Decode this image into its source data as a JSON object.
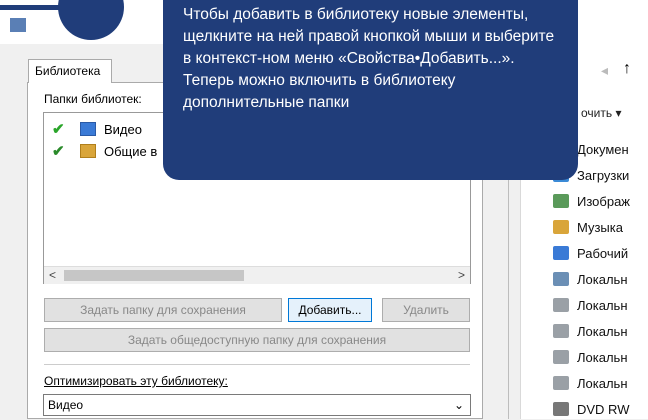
{
  "explorer": {
    "toolbar_label": "очить ▾",
    "nav_up": "↑",
    "sidebar": [
      {
        "label": "Докумен",
        "color": "#7a9cc6"
      },
      {
        "label": "Загрузки",
        "color": "#3a8ad6"
      },
      {
        "label": "Изображ",
        "color": "#5a9a5a"
      },
      {
        "label": "Музыка",
        "color": "#d9a53a"
      },
      {
        "label": "Рабочий",
        "color": "#3a7ad6"
      },
      {
        "label": "Локальн",
        "color": "#6b8fb5"
      },
      {
        "label": "Локальн",
        "color": "#9aa0a6"
      },
      {
        "label": "Локальн",
        "color": "#9aa0a6"
      },
      {
        "label": "Локальн",
        "color": "#9aa0a6"
      },
      {
        "label": "Локальн",
        "color": "#9aa0a6"
      },
      {
        "label": "DVD RW",
        "color": "#777"
      }
    ]
  },
  "dialog": {
    "tab_label": "Библиотека",
    "folders_label": "Папки библиотек:",
    "libraries": [
      {
        "check": "✔",
        "name": "Видео"
      },
      {
        "check": "✔",
        "name": "Общие в"
      }
    ],
    "scroll_left": "<",
    "scroll_right": ">",
    "buttons": {
      "save_folder": "Задать папку для сохранения",
      "add": "Добавить...",
      "remove": "Удалить",
      "public_save_folder": "Задать общедоступную папку для сохранения"
    },
    "optimize_label": "Оптимизировать эту библиотеку:",
    "optimize_value": "Видео",
    "optimize_chevron": "⌄"
  },
  "tooltip": {
    "text": "Чтобы добавить в библиотеку новые элементы, щелкните на ней правой кнопкой мыши и выберите в контекст-ном меню «Свойства•Добавить...». Теперь можно включить в библиотеку дополнительные папки"
  }
}
